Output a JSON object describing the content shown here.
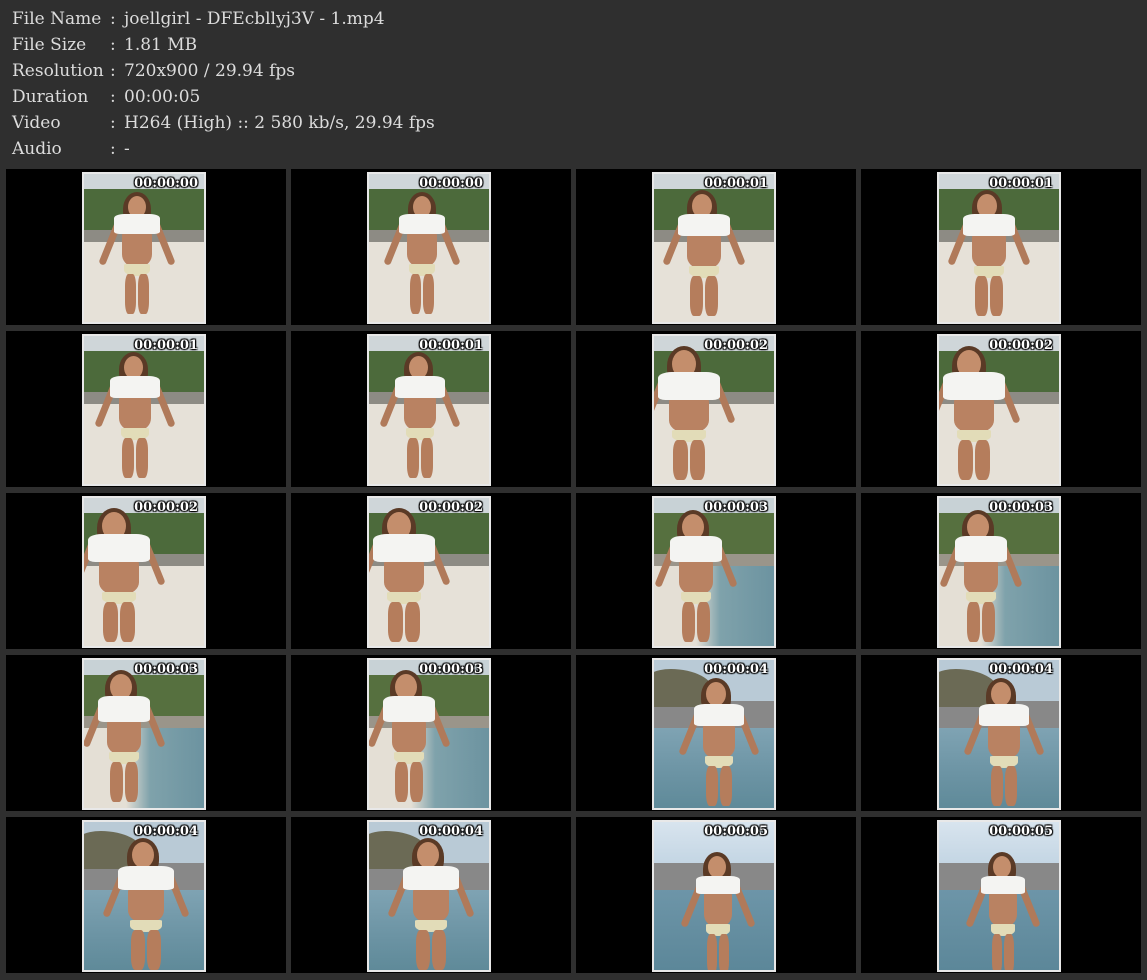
{
  "info": [
    {
      "label": "File Name",
      "value": "joellgirl - DFEcbllyj3V - 1.mp4"
    },
    {
      "label": "File Size",
      "value": "1.81 MB"
    },
    {
      "label": "Resolution",
      "value": "720x900 / 29.94 fps"
    },
    {
      "label": "Duration",
      "value": "00:00:05"
    },
    {
      "label": "Video",
      "value": "H264 (High) :: 2 580 kb/s, 29.94 fps"
    },
    {
      "label": "Audio",
      "value": "-"
    }
  ],
  "separator": ":",
  "thumbnails": [
    {
      "timestamp": "00:00:00",
      "scene": "beach-trees"
    },
    {
      "timestamp": "00:00:00",
      "scene": "beach-trees"
    },
    {
      "timestamp": "00:00:01",
      "scene": "beach-trees"
    },
    {
      "timestamp": "00:00:01",
      "scene": "beach-trees"
    },
    {
      "timestamp": "00:00:01",
      "scene": "beach-trees"
    },
    {
      "timestamp": "00:00:01",
      "scene": "beach-trees"
    },
    {
      "timestamp": "00:00:02",
      "scene": "beach-trees"
    },
    {
      "timestamp": "00:00:02",
      "scene": "beach-trees"
    },
    {
      "timestamp": "00:00:02",
      "scene": "beach-trees"
    },
    {
      "timestamp": "00:00:02",
      "scene": "beach-trees"
    },
    {
      "timestamp": "00:00:03",
      "scene": "shore"
    },
    {
      "timestamp": "00:00:03",
      "scene": "shore"
    },
    {
      "timestamp": "00:00:03",
      "scene": "shore"
    },
    {
      "timestamp": "00:00:03",
      "scene": "shore"
    },
    {
      "timestamp": "00:00:04",
      "scene": "sea-rock"
    },
    {
      "timestamp": "00:00:04",
      "scene": "sea-rock"
    },
    {
      "timestamp": "00:00:04",
      "scene": "sea-rock"
    },
    {
      "timestamp": "00:00:04",
      "scene": "sea-rock"
    },
    {
      "timestamp": "00:00:05",
      "scene": "open-sea"
    },
    {
      "timestamp": "00:00:05",
      "scene": "open-sea"
    }
  ],
  "colors": {
    "header_bg": "#2f2f2f",
    "cell_bg": "#000000",
    "text": "#dcdcdc",
    "thumb_border": "#e8e8e8"
  }
}
